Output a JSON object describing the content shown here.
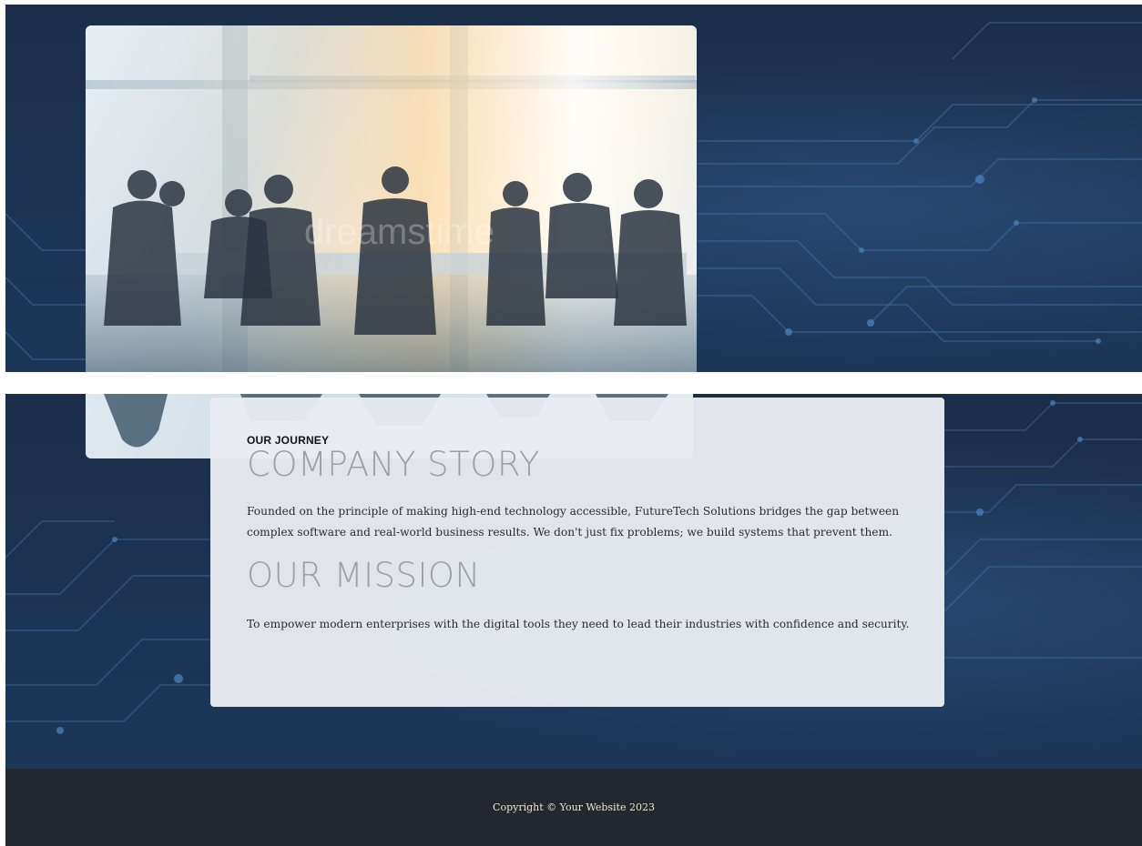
{
  "hero_image": {
    "semantic": "team-meeting-photo",
    "watermark": "dreamstime"
  },
  "story_card": {
    "eyebrow": "OUR JOURNEY",
    "story_title": "COMPANY STORY",
    "story_text": "Founded on the principle of making high-end technology accessible, FutureTech Solutions bridges the gap between complex software and real-world business results. We don't just fix problems; we build systems that prevent them.",
    "mission_title": "OUR MISSION",
    "mission_text": "To empower modern enterprises with the digital tools they need to lead their industries with confidence and security."
  },
  "footer": {
    "copyright": "Copyright © Your Website 2023"
  },
  "colors": {
    "background_navy": "#1c3658",
    "footer_dark": "#23272f",
    "card_bg": "#e9ecf1",
    "heading_gray": "#9aa0a7",
    "copyright_text": "#f2e6c8"
  }
}
